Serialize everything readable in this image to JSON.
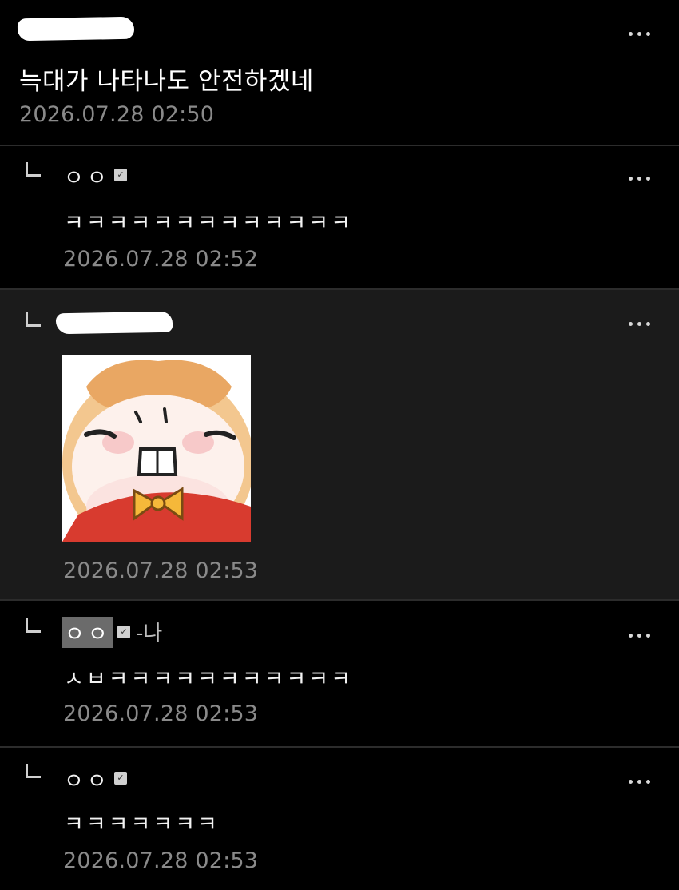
{
  "post": {
    "text": "늑대가 나타나도 안전하겠네",
    "time": "2026.07.28 02:50"
  },
  "comments": [
    {
      "nick": "ㅇㅇ",
      "text": "ㅋㅋㅋㅋㅋㅋㅋㅋㅋㅋㅋㅋㅋ",
      "time": "2026.07.28 02:52"
    },
    {
      "nick": "",
      "text": "",
      "time": "2026.07.28 02:53",
      "has_sticker": true
    },
    {
      "nick": "ㅇㅇ",
      "suffix": "-나",
      "text": "ㅅㅂㅋㅋㅋㅋㅋㅋㅋㅋㅋㅋㅋ",
      "time": "2026.07.28 02:53"
    },
    {
      "nick": "ㅇㅇ",
      "text": "ㅋㅋㅋㅋㅋㅋㅋ",
      "time": "2026.07.28 02:53"
    }
  ],
  "icons": {
    "more": "more-icon",
    "reply": "reply-arrow-icon",
    "badge": "fixed-nick-badge-icon"
  },
  "colors": {
    "background": "#000000",
    "highlight_row": "#1b1b1b",
    "timestamp": "#8a8a8a",
    "my_nick_bg": "#6b6b6b"
  }
}
